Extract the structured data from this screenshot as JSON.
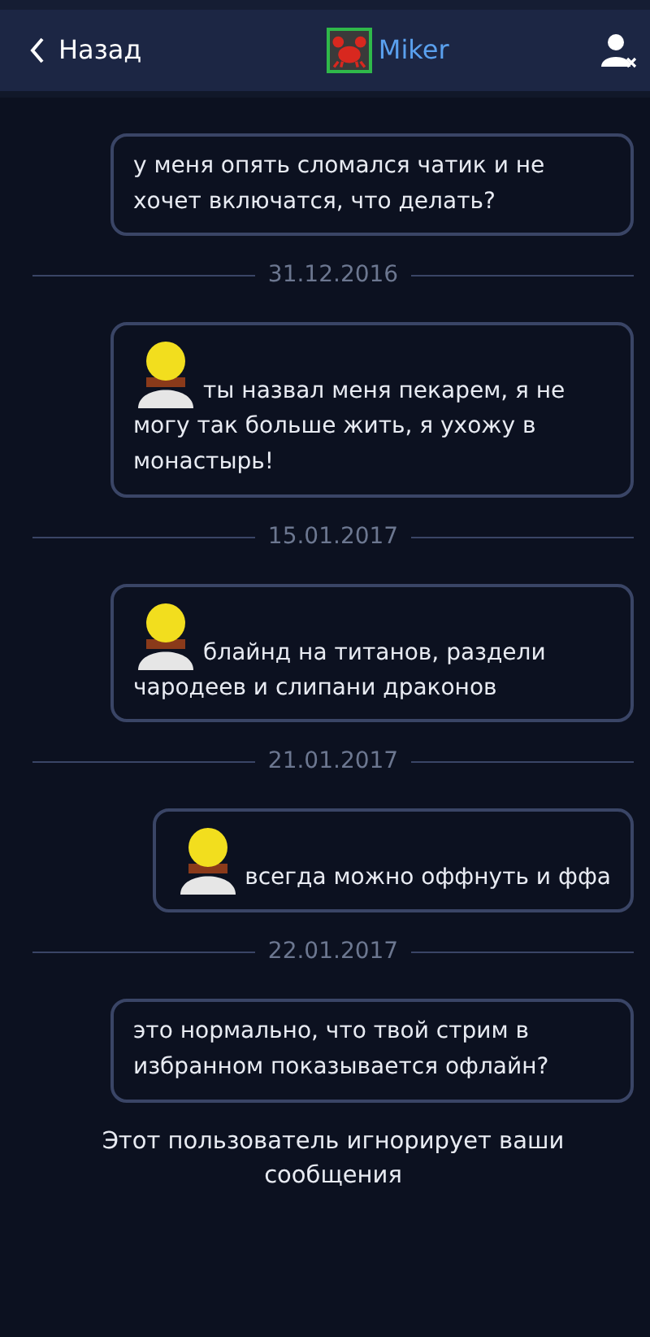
{
  "header": {
    "back": "Назад",
    "user": "Miker"
  },
  "feed": [
    {
      "kind": "text",
      "text": "у меня опять сломался чатик и не хочет включатся, что делать?"
    },
    {
      "kind": "date",
      "text": "31.12.2016"
    },
    {
      "kind": "emoticon",
      "text": "ты назвал меня пекарем, я не могу так больше жить, я ухожу в монастырь!"
    },
    {
      "kind": "date",
      "text": "15.01.2017"
    },
    {
      "kind": "emoticon",
      "text": "блайнд на титанов, раздели чародеев и слипани драконов"
    },
    {
      "kind": "date",
      "text": "21.01.2017"
    },
    {
      "kind": "emoticon",
      "text": "всегда можно оффнуть и ффа"
    },
    {
      "kind": "date",
      "text": "22.01.2017"
    },
    {
      "kind": "text",
      "text": "это нормально, что твой стрим в избранном показывается офлайн?"
    }
  ],
  "notice": "Этот пользователь игнорирует ваши сообщения"
}
